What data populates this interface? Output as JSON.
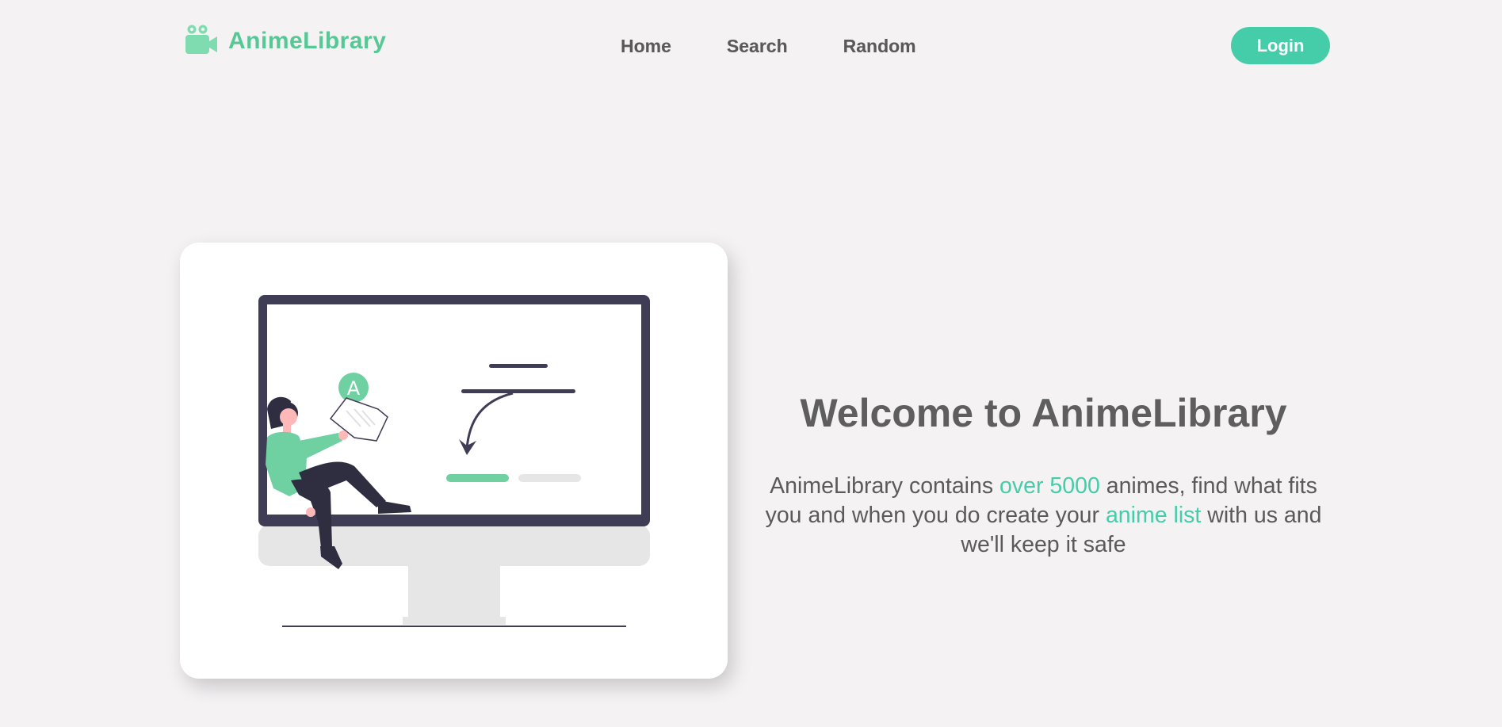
{
  "brand": {
    "name": "AnimeLibrary",
    "icon": "video-camera-icon",
    "color": "#55c896"
  },
  "nav": {
    "items": [
      {
        "label": "Home"
      },
      {
        "label": "Search"
      },
      {
        "label": "Random"
      }
    ]
  },
  "login": {
    "label": "Login",
    "color": "#45cca9"
  },
  "hero": {
    "title": "Welcome to AnimeLibrary",
    "description": {
      "part1": "AnimeLibrary contains ",
      "highlight1": "over 5000",
      "part2": " animes, find what fits you and when you do create your ",
      "highlight2": "anime list",
      "part3": " with us and we'll keep it safe"
    },
    "illustration": {
      "icon": "person-with-monitor-illustration",
      "badge_letter": "A"
    },
    "accent_color": "#45cca9"
  }
}
